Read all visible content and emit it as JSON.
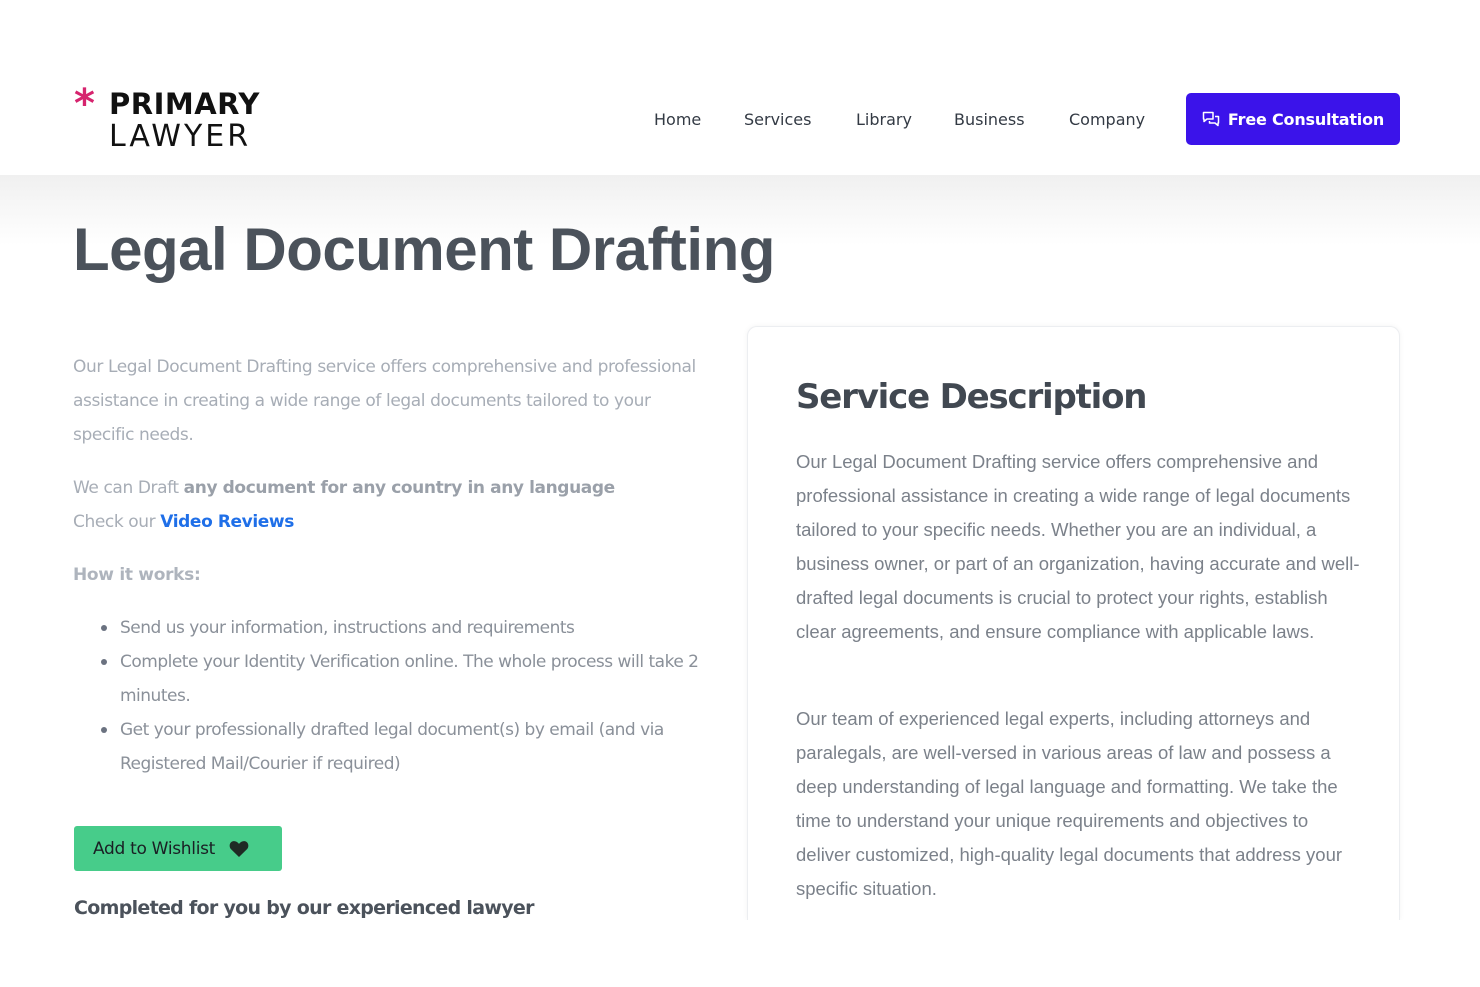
{
  "brand": {
    "star": "*",
    "line1": "PRIMARY",
    "line2": "LAWYER",
    "accent_color": "#d6246e"
  },
  "nav": {
    "items": [
      {
        "label": "Home"
      },
      {
        "label": "Services"
      },
      {
        "label": "Library"
      },
      {
        "label": "Business"
      },
      {
        "label": "Company"
      }
    ],
    "cta": {
      "label": "Free Consultation",
      "icon": "chat-bubbles-icon",
      "color": "#3b13ea"
    }
  },
  "page": {
    "title": "Legal Document Drafting"
  },
  "intro": {
    "lead": "Our Legal Document Drafting service offers comprehensive and professional assistance in creating a wide range of legal documents tailored to your specific needs.",
    "draft_prefix": "We can Draft ",
    "draft_bold": "any document for any country in any language",
    "check_prefix": "Check our ",
    "video_link": "Video Reviews",
    "how_heading": "How it works:",
    "steps": [
      "Send us your information, instructions and requirements",
      "Complete your Identity Verification online. The whole process will take 2 minutes.",
      "Get your professionally drafted legal document(s) by email (and via Registered Mail/Courier if required)"
    ],
    "wishlist": {
      "label": "Add to Wishlist",
      "icon": "heart-icon",
      "color": "#47cc8a"
    },
    "completed": "Completed for you by our experienced lawyer"
  },
  "service_description": {
    "title": "Service Description",
    "p1": "Our Legal Document Drafting service offers comprehensive and professional assistance in creating a wide range of legal documents tailored to your specific needs. Whether you are an individual, a business owner, or part of an organization, having accurate and well-drafted legal documents is crucial to protect your rights, establish clear agreements, and ensure compliance with applicable laws.",
    "p2": "Our team of experienced legal experts, including attorneys and paralegals, are well-versed in various areas of law and possess a deep understanding of legal language and formatting. We take the time to understand your unique requirements and objectives to deliver customized, high-quality legal documents that address your specific situation."
  }
}
